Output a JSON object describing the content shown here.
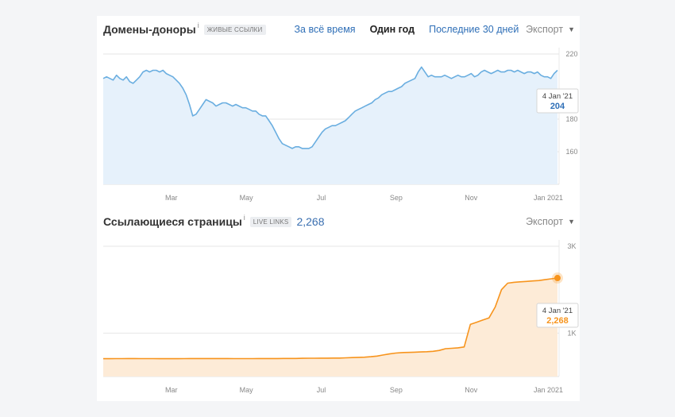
{
  "top": {
    "title": "Домены-доноры",
    "info_icon": "i",
    "badge": "ЖИВЫЕ ССЫЛКИ",
    "tabs": [
      {
        "label": "За всё время",
        "active": false
      },
      {
        "label": "Один год",
        "active": true
      },
      {
        "label": "Последние 30 дней",
        "active": false
      }
    ],
    "export_label": "Экспорт",
    "tooltip": {
      "date": "4 Jan '21",
      "value": "204"
    }
  },
  "bottom": {
    "title": "Ссылающиеся страницы",
    "info_icon": "i",
    "badge": "LIVE LINKS",
    "total": "2,268",
    "export_label": "Экспорт",
    "tooltip": {
      "date": "4 Jan '21",
      "value": "2,268"
    }
  },
  "colors": {
    "line_blue": "#6aaee0",
    "fill_blue": "#e6f1fb",
    "line_orange": "#f7941d",
    "fill_orange": "#fdebd7",
    "link": "#2f6fb7"
  },
  "chart_data": [
    {
      "type": "area",
      "series": [
        {
          "values": [
            205,
            206,
            205,
            204,
            207,
            205,
            204,
            206,
            203,
            202,
            204,
            206,
            209,
            210,
            209,
            210,
            210,
            209,
            210,
            208,
            207,
            206,
            204,
            202,
            199,
            195,
            189,
            182,
            183,
            186,
            189,
            192,
            191,
            190,
            188,
            189,
            190,
            190,
            189,
            188,
            189,
            188,
            187,
            187,
            186,
            185,
            185,
            183,
            182,
            182,
            179,
            176,
            172,
            168,
            165,
            164,
            163,
            162,
            163,
            163,
            162,
            162,
            162,
            163,
            166,
            169,
            172,
            174,
            175,
            176,
            176,
            177,
            178,
            179,
            181,
            183,
            185,
            186,
            187,
            188,
            189,
            190,
            192,
            193,
            195,
            196,
            197,
            197,
            198,
            199,
            200,
            202,
            203,
            204,
            205,
            209,
            212,
            209,
            206,
            207,
            206,
            206,
            206,
            207,
            206,
            205,
            206,
            207,
            206,
            206,
            207,
            208,
            206,
            207,
            209,
            210,
            209,
            208,
            209,
            210,
            209,
            209,
            210,
            210,
            209,
            210,
            209,
            208,
            209,
            209,
            208,
            209,
            207,
            206,
            206,
            205,
            208,
            210
          ]
        }
      ],
      "x_ticks": [
        "Mar",
        "May",
        "Jul",
        "Sep",
        "Nov",
        "Jan 2021"
      ],
      "y_ticks": [
        "220",
        "180",
        "160"
      ],
      "ylim": [
        140,
        220
      ]
    },
    {
      "type": "area",
      "series": [
        {
          "values": [
            410,
            410,
            412,
            412,
            413,
            413,
            412,
            412,
            411,
            410,
            409,
            409,
            410,
            412,
            413,
            414,
            414,
            414,
            414,
            413,
            413,
            412,
            412,
            412,
            412,
            413,
            413,
            414,
            414,
            415,
            416,
            416,
            418,
            420,
            421,
            422,
            423,
            424,
            425,
            430,
            435,
            440,
            445,
            455,
            470,
            495,
            520,
            540,
            550,
            555,
            560,
            565,
            570,
            580,
            600,
            640,
            650,
            660,
            680,
            1200,
            1250,
            1300,
            1350,
            1600,
            2000,
            2150,
            2170,
            2180,
            2190,
            2200,
            2210,
            2230,
            2250,
            2268
          ]
        }
      ],
      "x_ticks": [
        "Mar",
        "May",
        "Jul",
        "Sep",
        "Nov",
        "Jan 2021"
      ],
      "y_ticks": [
        "3K",
        "1K"
      ],
      "ylim": [
        0,
        3000
      ]
    }
  ]
}
